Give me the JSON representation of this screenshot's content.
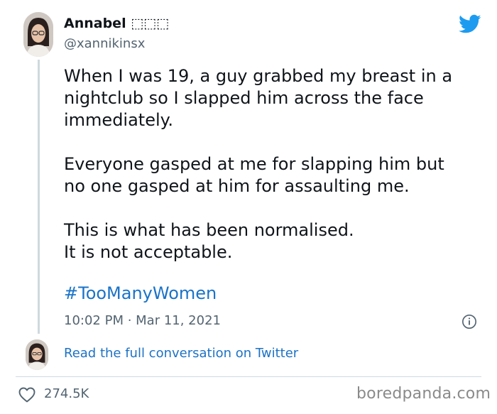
{
  "author": {
    "name": "Annabel ⬚⬚⬚",
    "handle": "@xannikinsx"
  },
  "tweet": {
    "line1": "When I was 19, a guy grabbed my breast in a",
    "line2": "nightclub so I slapped him across the face",
    "line3": "immediately.",
    "line4": "Everyone gasped at me for slapping him but",
    "line5": "no one gasped at him for assaulting me.",
    "line6": "This is what has been normalised.",
    "line7": "It is not acceptable.",
    "hashtag": "#TooManyWomen",
    "timestamp": "10:02 PM · Mar 11, 2021"
  },
  "conversation_link": "Read the full conversation on Twitter",
  "likes": "274.5K",
  "watermark": "boredpanda.com",
  "colors": {
    "twitter_blue": "#1d9bf0",
    "link": "#1d72c5",
    "text": "#0f1419",
    "muted": "#536471"
  },
  "icons": [
    "twitter-bird-icon",
    "info-icon",
    "heart-icon"
  ]
}
